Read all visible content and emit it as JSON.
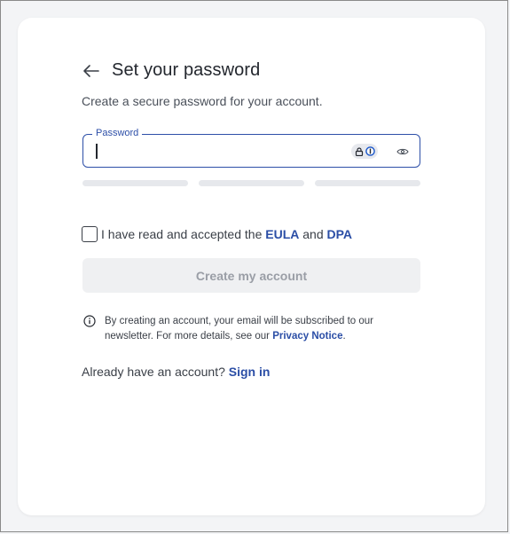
{
  "header": {
    "title": "Set your password"
  },
  "subtitle": "Create a secure password for your account.",
  "password_field": {
    "label": "Password",
    "value": ""
  },
  "strength_meter": {
    "segments": 3,
    "filled": 0
  },
  "terms": {
    "prefix": "I have read and accepted the ",
    "eula_link": "EULA",
    "and_text": " and ",
    "dpa_link": "DPA",
    "checked": false
  },
  "create_button": {
    "label": "Create my account",
    "enabled": false
  },
  "notice": {
    "text": "By creating an account, your email will be subscribed to our newsletter. For more details, see our ",
    "link": "Privacy Notice",
    "suffix": "."
  },
  "signin": {
    "prefix": "Already have an account? ",
    "link": "Sign in"
  },
  "colors": {
    "accent": "#2d4fa8",
    "link": "#2b4ea6",
    "disabled_bg": "#eff0f2",
    "disabled_text": "#9a9ea6"
  },
  "icons": {
    "back": "arrow-left-icon",
    "password_manager": "password-manager-icon",
    "reveal": "eye-icon",
    "info": "info-icon"
  }
}
